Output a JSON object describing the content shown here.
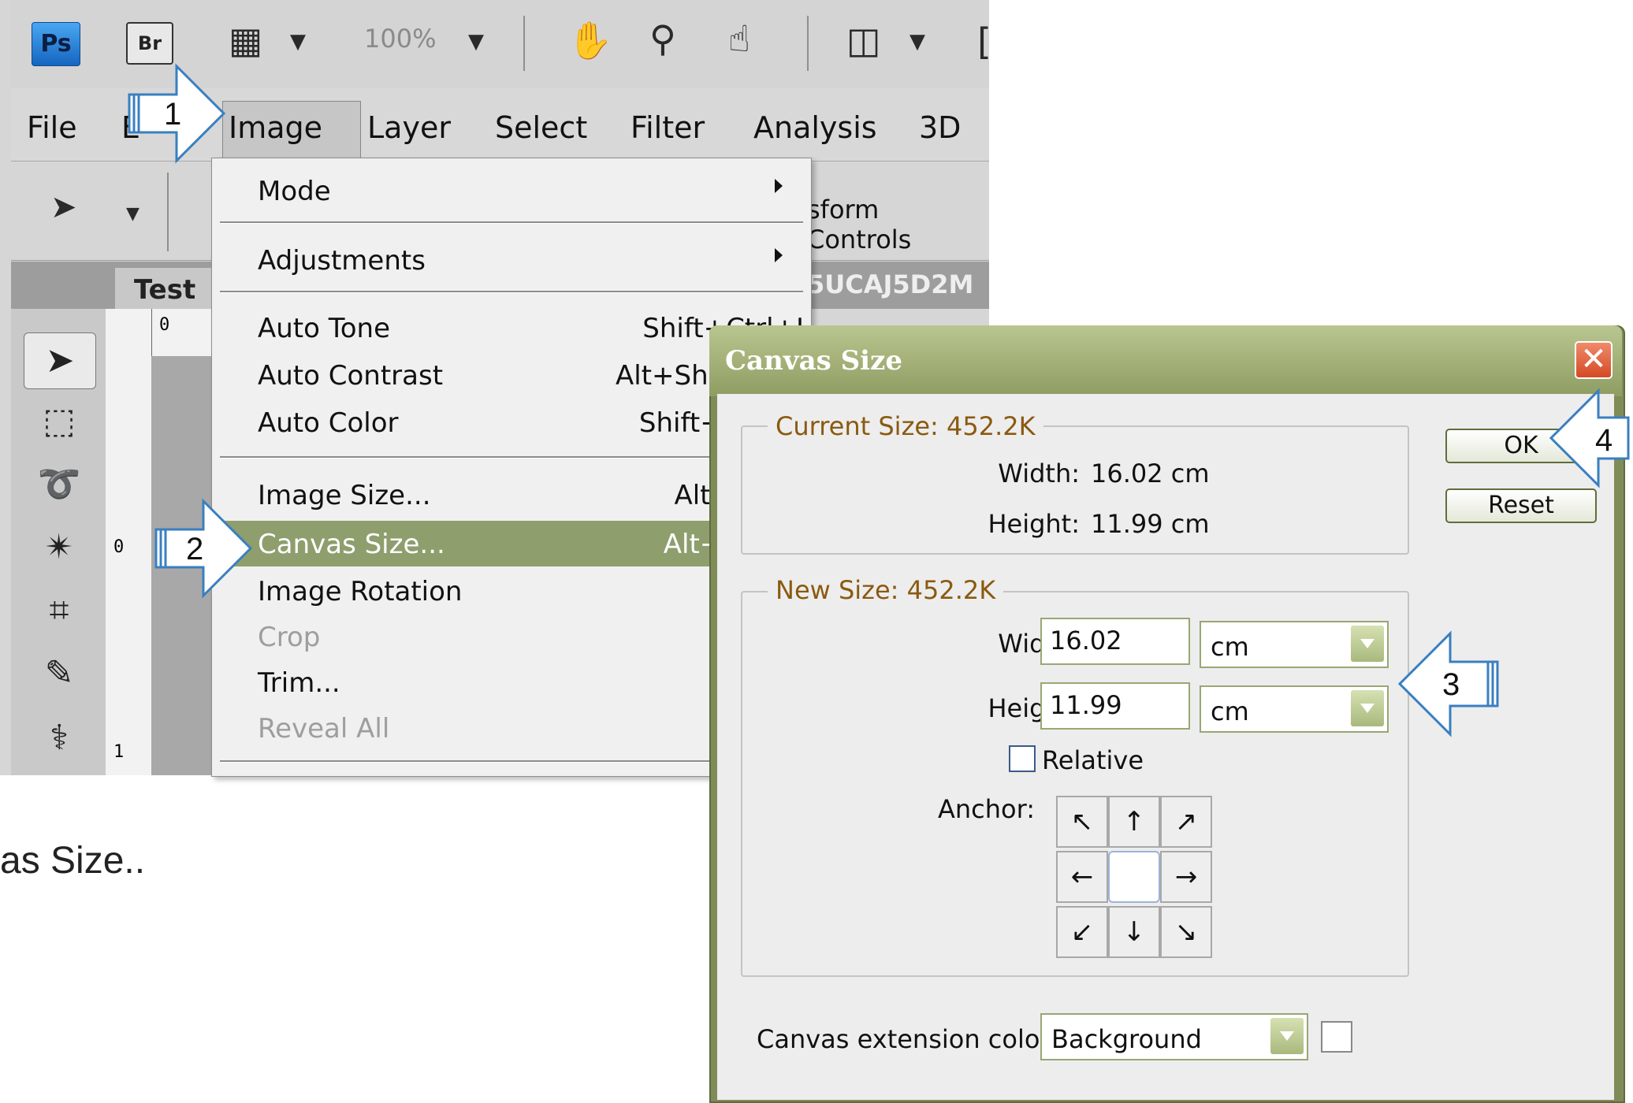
{
  "app_bar": {
    "ps_logo": "Ps",
    "br_logo": "Br",
    "zoom": "100%",
    "icons": [
      "layout-icon",
      "dropdown-icon",
      "hand-icon",
      "zoom-icon",
      "rotate-view-icon",
      "arrange-icon"
    ]
  },
  "menubar": {
    "items": [
      "File",
      "E",
      "Image",
      "Layer",
      "Select",
      "Filter",
      "Analysis",
      "3D"
    ]
  },
  "options_bar": {
    "transform_controls": "sform Controls"
  },
  "doc_tab": {
    "title": "Test",
    "other_title": "5UCAJ5D2M"
  },
  "rulers": {
    "h0": "0",
    "v0": "0",
    "v1": "1"
  },
  "image_menu": {
    "items": [
      {
        "label": "Mode",
        "shortcut": "",
        "submenu": true
      },
      {
        "label": "Adjustments",
        "shortcut": "",
        "submenu": true
      },
      {
        "label": "Auto Tone",
        "shortcut": "Shift+Ctrl+L"
      },
      {
        "label": "Auto Contrast",
        "shortcut": "Alt+Shift+Ctrl+L"
      },
      {
        "label": "Auto Color",
        "shortcut": "Shift+Ctrl+B"
      },
      {
        "label": "Image Size...",
        "shortcut": "Alt+Ctrl+I"
      },
      {
        "label": "Canvas Size...",
        "shortcut": "Alt+Ctrl+C"
      },
      {
        "label": "Image Rotation",
        "shortcut": ""
      },
      {
        "label": "Crop",
        "shortcut": ""
      },
      {
        "label": "Trim...",
        "shortcut": ""
      },
      {
        "label": "Reveal All",
        "shortcut": ""
      }
    ]
  },
  "caption": "as Size..",
  "dialog": {
    "title": "Canvas Size",
    "close": "✕",
    "ok": "OK",
    "reset": "Reset",
    "current": {
      "title": "Current Size: 452.2K",
      "width_label": "Width:",
      "width_value": "16.02 cm",
      "height_label": "Height:",
      "height_value": "11.99 cm"
    },
    "new": {
      "title": "New Size: 452.2K",
      "width_label": "Width:",
      "width_value": "16.02",
      "width_unit": "cm",
      "height_label": "Height:",
      "height_value": "11.99",
      "height_unit": "cm",
      "relative_label": "Relative",
      "relative_checked": false,
      "anchor_label": "Anchor:",
      "anchor_arrows": [
        "↖",
        "↑",
        "↗",
        "←",
        "",
        "→",
        "↙",
        "↓",
        "↘"
      ]
    },
    "extension_label": "Canvas extension color:",
    "extension_value": "Background",
    "extension_swatch_color": "#ffffff"
  },
  "callouts": [
    "1",
    "2",
    "3",
    "4"
  ]
}
